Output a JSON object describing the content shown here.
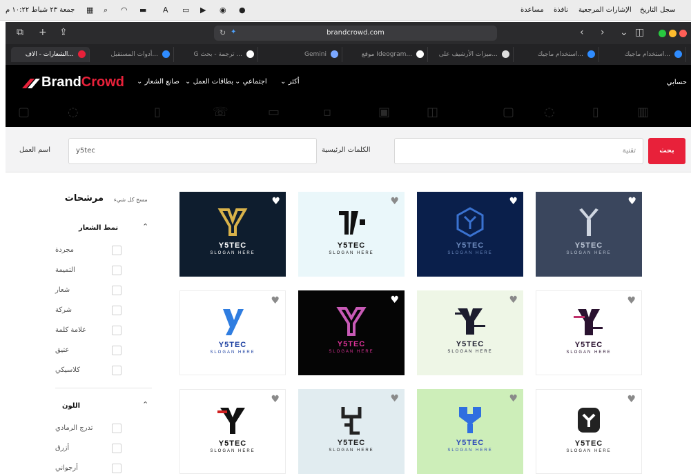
{
  "menubar": {
    "apple_items": [
      "سجل التاريخ",
      "الإشارات المرجعية",
      "نافذة",
      "مساعدة"
    ],
    "clock": "جمعة ٢٣ شباط ١٠:٢٢ م",
    "icons": [
      "control-center-icon",
      "search-icon",
      "wifi-icon",
      "battery-icon",
      "input-source-icon",
      "display-icon",
      "play-icon",
      "app-icon-1",
      "app-icon-2"
    ]
  },
  "browser": {
    "url": "brandcrowd.com",
    "tabs": [
      {
        "label": "الشعارات - الاف...",
        "active": true,
        "fav_color": "#e8213a"
      },
      {
        "label": "أدوات المستقبل...",
        "active": false,
        "fav_color": "#2f8cff"
      },
      {
        "label": "G ترجمة - بحث ...",
        "active": false,
        "fav_color": "#ffffff"
      },
      {
        "label": "Gemini",
        "active": false,
        "fav_color": "#7aa7ff"
      },
      {
        "label": "موقع Ideogram...",
        "active": false,
        "fav_color": "#ffffff"
      },
      {
        "label": "ميزات الأرشيف على...",
        "active": false,
        "fav_color": "#dddddd"
      },
      {
        "label": "استخدام ماجيك...",
        "active": false,
        "fav_color": "#2f8cff"
      },
      {
        "label": "استخدام ماجيك...",
        "active": false,
        "fav_color": "#2f8cff"
      }
    ]
  },
  "site": {
    "logo_brand": "Brand",
    "logo_crowd": "Crowd",
    "nav": [
      "صانع الشعار",
      "بطاقات العمل",
      "اجتماعي",
      "أكثر"
    ],
    "account": "حسابي"
  },
  "search": {
    "button": "بحث",
    "keywords_label": "الكلمات الرئيسية",
    "keywords_value": "تقنية",
    "name_label": "اسم العمل",
    "name_value": "y5tec"
  },
  "filters": {
    "title": "مرشحات",
    "clear": "مسح كل شيء",
    "style_section": "نمط الشعار",
    "style_options": [
      "مجردة",
      "التميمة",
      "شعار",
      "شركة",
      "علامة كلمة",
      "عتيق",
      "كلاسيكي"
    ],
    "color_section": "اللون",
    "color_options": [
      "تدرج الرمادي",
      "أزرق",
      "أرجواني"
    ]
  },
  "cards": [
    {
      "name": "Y5TEC",
      "slogan": "SLOGAN HERE",
      "bg": "#0e1d2e",
      "fg": "#ffffff",
      "accent": "#d8b24a",
      "heart": "#ffffff",
      "mark": "y-gold"
    },
    {
      "name": "Y5TEC",
      "slogan": "SLOGAN HERE",
      "bg": "#eaf7fa",
      "fg": "#111111",
      "accent": "#111111",
      "heart": "#8a8a8a",
      "mark": "y-dot"
    },
    {
      "name": "Y5TEC",
      "slogan": "SLOGAN HERE",
      "bg": "#0a1f4b",
      "fg": "#6d8bbf",
      "accent": "#3a72d0",
      "heart": "#ffffff",
      "mark": "y-hex"
    },
    {
      "name": "Y5TEC",
      "slogan": "SLOGAN HERE",
      "bg": "#3a465d",
      "fg": "#b9c3d3",
      "accent": "#cfd6e1",
      "heart": "#ffffff",
      "mark": "y-silver"
    },
    {
      "name": "Y5TEC",
      "slogan": "SLOGAN HERE",
      "bg": "#ffffff",
      "fg": "#1a3ea0",
      "accent": "#2f7de0",
      "heart": "#8a8a8a",
      "mark": "y-blue"
    },
    {
      "name": "Y5TEC",
      "slogan": "SLOGAN HERE",
      "bg": "#050505",
      "fg": "#e0339a",
      "accent": "#c85ab6",
      "heart": "#ffffff",
      "mark": "y-pink"
    },
    {
      "name": "Y5TEC",
      "slogan": "SLOGAN HERE",
      "bg": "#eef6e6",
      "fg": "#1c1c2e",
      "accent": "#1c1c2e",
      "heart": "#8a8a8a",
      "mark": "y-glitch"
    },
    {
      "name": "Y5TEC",
      "slogan": "SLOGAN HERE",
      "bg": "#ffffff",
      "fg": "#2a1230",
      "accent": "#2a1230",
      "heart": "#8a8a8a",
      "mark": "y-glitch2"
    },
    {
      "name": "Y5TEC",
      "slogan": "SLOGAN HERE",
      "bg": "#ffffff",
      "fg": "#111111",
      "accent": "#111111",
      "heart": "#8a8a8a",
      "mark": "y-black"
    },
    {
      "name": "Y5TEC",
      "slogan": "SLOGAN HERE",
      "bg": "#e1ecf0",
      "fg": "#222222",
      "accent": "#222222",
      "heart": "#8a8a8a",
      "mark": "y-mono"
    },
    {
      "name": "Y5TEC",
      "slogan": "SLOGAN HERE",
      "bg": "#cdeeb9",
      "fg": "#2b48b8",
      "accent": "#2f6fe0",
      "heart": "#8a8a8a",
      "mark": "y-shield"
    },
    {
      "name": "Y5TEC",
      "slogan": "SLOGAN HERE",
      "bg": "#ffffff",
      "fg": "#222222",
      "accent": "#222222",
      "heart": "#8a8a8a",
      "mark": "y-rounded"
    }
  ]
}
